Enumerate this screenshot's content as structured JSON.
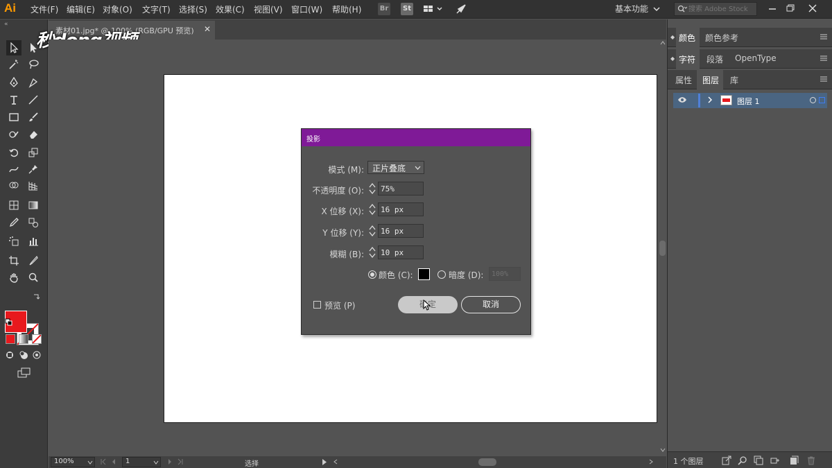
{
  "app": {
    "logo": "Ai"
  },
  "menu": [
    "文件(F)",
    "编辑(E)",
    "对象(O)",
    "文字(T)",
    "选择(S)",
    "效果(C)",
    "视图(V)",
    "窗口(W)",
    "帮助(H)"
  ],
  "menubar": {
    "bridge_label": "Br",
    "stock_label": "St",
    "workspace": "基本功能",
    "search_placeholder": "搜索 Adobe Stock"
  },
  "document": {
    "tab_title": "素材01.jpg* @ 100% (RGB/GPU 预览)",
    "watermark": "秒dong视频"
  },
  "colors": {
    "fill": "#e8191d",
    "dialog_title_bg": "#7f1a97",
    "shadow_color": "#000000",
    "layer_highlight": "#4a6582"
  },
  "status": {
    "zoom": "100%",
    "artboard": "1",
    "tool": "选择"
  },
  "panels": {
    "row1": [
      "颜色",
      "颜色参考"
    ],
    "row2": [
      "字符",
      "段落",
      "OpenType"
    ],
    "row3": [
      "属性",
      "图层",
      "库"
    ],
    "layers": [
      {
        "name": "图层 1",
        "visible": true
      }
    ],
    "layer_count": "1 个图层"
  },
  "dialog": {
    "title": "投影",
    "mode_label": "模式 (M):",
    "mode_value": "正片叠底",
    "opacity_label": "不透明度 (O):",
    "opacity_value": "75%",
    "x_label": "X 位移 (X):",
    "x_value": "16 px",
    "y_label": "Y 位移 (Y):",
    "y_value": "16 px",
    "blur_label": "模糊 (B):",
    "blur_value": "10 px",
    "color_label": "颜色 (C):",
    "color_selected": true,
    "darkness_label": "暗度 (D):",
    "darkness_value": "100%",
    "preview_label": "预览 (P)",
    "preview_checked": false,
    "ok_label": "确定",
    "cancel_label": "取消"
  }
}
